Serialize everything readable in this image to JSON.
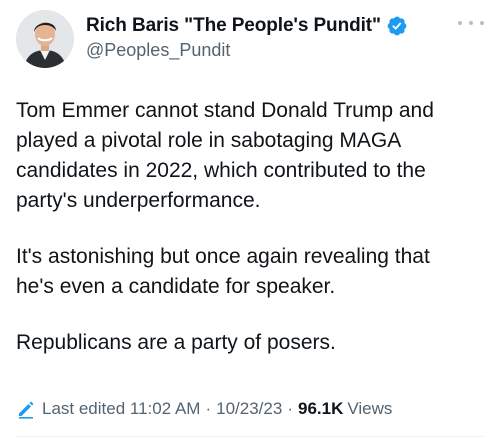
{
  "author": {
    "display_name": "Rich Baris \"The People's Pundit\"",
    "handle": "@Peoples_Pundit",
    "verified": true,
    "verified_color": "#1d9bf0"
  },
  "tweet": {
    "paragraphs": [
      [
        "Tom Emmer cannot stand Donald Trump and",
        "played a pivotal role in sabotaging MAGA",
        "candidates in 2022, which contributed to the",
        "party's underperformance."
      ],
      [
        "It's astonishing but once again revealing that",
        "he's even a candidate for speaker."
      ],
      [
        "Republicans are a party of posers."
      ]
    ]
  },
  "meta": {
    "last_edited_label": "Last edited 11:02 AM",
    "date": "10/23/23",
    "separator": "·",
    "views_count": "96.1K",
    "views_label": "Views",
    "edit_icon": "pencil-icon",
    "accent_color": "#1d9bf0"
  },
  "icons": {
    "more": "more-options-icon"
  }
}
